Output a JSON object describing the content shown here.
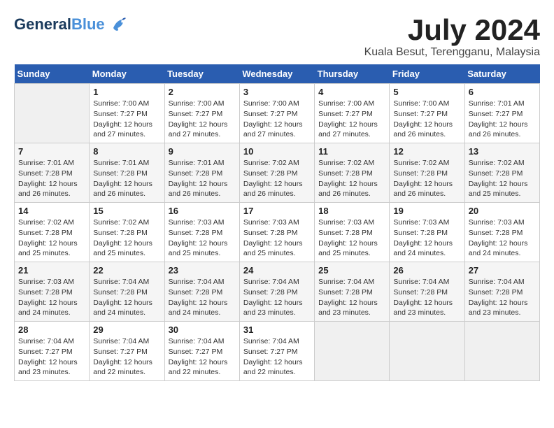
{
  "logo": {
    "general": "General",
    "blue": "Blue"
  },
  "title": "July 2024",
  "location": "Kuala Besut, Terengganu, Malaysia",
  "headers": [
    "Sunday",
    "Monday",
    "Tuesday",
    "Wednesday",
    "Thursday",
    "Friday",
    "Saturday"
  ],
  "weeks": [
    [
      {
        "day": "",
        "info": ""
      },
      {
        "day": "1",
        "info": "Sunrise: 7:00 AM\nSunset: 7:27 PM\nDaylight: 12 hours\nand 27 minutes."
      },
      {
        "day": "2",
        "info": "Sunrise: 7:00 AM\nSunset: 7:27 PM\nDaylight: 12 hours\nand 27 minutes."
      },
      {
        "day": "3",
        "info": "Sunrise: 7:00 AM\nSunset: 7:27 PM\nDaylight: 12 hours\nand 27 minutes."
      },
      {
        "day": "4",
        "info": "Sunrise: 7:00 AM\nSunset: 7:27 PM\nDaylight: 12 hours\nand 27 minutes."
      },
      {
        "day": "5",
        "info": "Sunrise: 7:00 AM\nSunset: 7:27 PM\nDaylight: 12 hours\nand 26 minutes."
      },
      {
        "day": "6",
        "info": "Sunrise: 7:01 AM\nSunset: 7:27 PM\nDaylight: 12 hours\nand 26 minutes."
      }
    ],
    [
      {
        "day": "7",
        "info": "Sunrise: 7:01 AM\nSunset: 7:28 PM\nDaylight: 12 hours\nand 26 minutes."
      },
      {
        "day": "8",
        "info": "Sunrise: 7:01 AM\nSunset: 7:28 PM\nDaylight: 12 hours\nand 26 minutes."
      },
      {
        "day": "9",
        "info": "Sunrise: 7:01 AM\nSunset: 7:28 PM\nDaylight: 12 hours\nand 26 minutes."
      },
      {
        "day": "10",
        "info": "Sunrise: 7:02 AM\nSunset: 7:28 PM\nDaylight: 12 hours\nand 26 minutes."
      },
      {
        "day": "11",
        "info": "Sunrise: 7:02 AM\nSunset: 7:28 PM\nDaylight: 12 hours\nand 26 minutes."
      },
      {
        "day": "12",
        "info": "Sunrise: 7:02 AM\nSunset: 7:28 PM\nDaylight: 12 hours\nand 26 minutes."
      },
      {
        "day": "13",
        "info": "Sunrise: 7:02 AM\nSunset: 7:28 PM\nDaylight: 12 hours\nand 25 minutes."
      }
    ],
    [
      {
        "day": "14",
        "info": "Sunrise: 7:02 AM\nSunset: 7:28 PM\nDaylight: 12 hours\nand 25 minutes."
      },
      {
        "day": "15",
        "info": "Sunrise: 7:02 AM\nSunset: 7:28 PM\nDaylight: 12 hours\nand 25 minutes."
      },
      {
        "day": "16",
        "info": "Sunrise: 7:03 AM\nSunset: 7:28 PM\nDaylight: 12 hours\nand 25 minutes."
      },
      {
        "day": "17",
        "info": "Sunrise: 7:03 AM\nSunset: 7:28 PM\nDaylight: 12 hours\nand 25 minutes."
      },
      {
        "day": "18",
        "info": "Sunrise: 7:03 AM\nSunset: 7:28 PM\nDaylight: 12 hours\nand 25 minutes."
      },
      {
        "day": "19",
        "info": "Sunrise: 7:03 AM\nSunset: 7:28 PM\nDaylight: 12 hours\nand 24 minutes."
      },
      {
        "day": "20",
        "info": "Sunrise: 7:03 AM\nSunset: 7:28 PM\nDaylight: 12 hours\nand 24 minutes."
      }
    ],
    [
      {
        "day": "21",
        "info": "Sunrise: 7:03 AM\nSunset: 7:28 PM\nDaylight: 12 hours\nand 24 minutes."
      },
      {
        "day": "22",
        "info": "Sunrise: 7:04 AM\nSunset: 7:28 PM\nDaylight: 12 hours\nand 24 minutes."
      },
      {
        "day": "23",
        "info": "Sunrise: 7:04 AM\nSunset: 7:28 PM\nDaylight: 12 hours\nand 24 minutes."
      },
      {
        "day": "24",
        "info": "Sunrise: 7:04 AM\nSunset: 7:28 PM\nDaylight: 12 hours\nand 23 minutes."
      },
      {
        "day": "25",
        "info": "Sunrise: 7:04 AM\nSunset: 7:28 PM\nDaylight: 12 hours\nand 23 minutes."
      },
      {
        "day": "26",
        "info": "Sunrise: 7:04 AM\nSunset: 7:28 PM\nDaylight: 12 hours\nand 23 minutes."
      },
      {
        "day": "27",
        "info": "Sunrise: 7:04 AM\nSunset: 7:28 PM\nDaylight: 12 hours\nand 23 minutes."
      }
    ],
    [
      {
        "day": "28",
        "info": "Sunrise: 7:04 AM\nSunset: 7:27 PM\nDaylight: 12 hours\nand 23 minutes."
      },
      {
        "day": "29",
        "info": "Sunrise: 7:04 AM\nSunset: 7:27 PM\nDaylight: 12 hours\nand 22 minutes."
      },
      {
        "day": "30",
        "info": "Sunrise: 7:04 AM\nSunset: 7:27 PM\nDaylight: 12 hours\nand 22 minutes."
      },
      {
        "day": "31",
        "info": "Sunrise: 7:04 AM\nSunset: 7:27 PM\nDaylight: 12 hours\nand 22 minutes."
      },
      {
        "day": "",
        "info": ""
      },
      {
        "day": "",
        "info": ""
      },
      {
        "day": "",
        "info": ""
      }
    ]
  ]
}
